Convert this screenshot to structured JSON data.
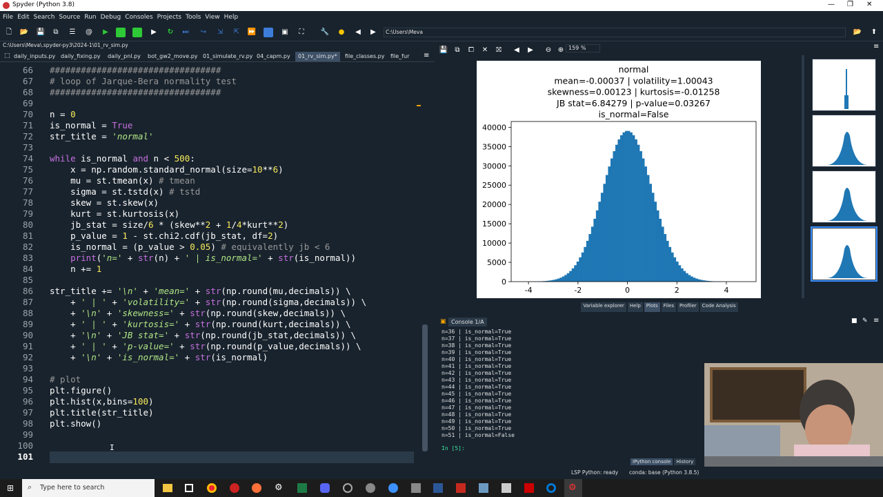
{
  "window": {
    "title": "Spyder (Python 3.8)"
  },
  "menu": [
    "File",
    "Edit",
    "Search",
    "Source",
    "Run",
    "Debug",
    "Consoles",
    "Projects",
    "Tools",
    "View",
    "Help"
  ],
  "toolbar": {
    "cwd": "C:\\Users\\Meva"
  },
  "editor": {
    "path": "C:\\Users\\Meva\\.spyder-py3\\2024-1\\01_rv_sim.py",
    "tabs": [
      "daily_inputs.py",
      "daily_fixing.py",
      "daily_pnl.py",
      "bot_gw2_move.py",
      "01_simulate_rv.py",
      "04_capm.py",
      "01_rv_sim.py*",
      "file_classes.py",
      "file_fur"
    ],
    "active_tab": 6,
    "lines": [
      {
        "n": "66",
        "t": "#################################"
      },
      {
        "n": "67",
        "t": "# loop of Jarque-Bera normality test"
      },
      {
        "n": "68",
        "t": "#################################"
      },
      {
        "n": "69",
        "t": ""
      },
      {
        "n": "70",
        "t": "n = 0"
      },
      {
        "n": "71",
        "t": "is_normal = True"
      },
      {
        "n": "72",
        "t": "str_title = 'normal'"
      },
      {
        "n": "73",
        "t": ""
      },
      {
        "n": "74",
        "t": "while is_normal and n < 500:"
      },
      {
        "n": "75",
        "t": "    x = np.random.standard_normal(size=10**6)"
      },
      {
        "n": "76",
        "t": "    mu = st.tmean(x) # tmean"
      },
      {
        "n": "77",
        "t": "    sigma = st.tstd(x) # tstd"
      },
      {
        "n": "78",
        "t": "    skew = st.skew(x)"
      },
      {
        "n": "79",
        "t": "    kurt = st.kurtosis(x)"
      },
      {
        "n": "80",
        "t": "    jb_stat = size/6 * (skew**2 + 1/4*kurt**2)"
      },
      {
        "n": "81",
        "t": "    p_value = 1 - st.chi2.cdf(jb_stat, df=2)"
      },
      {
        "n": "82",
        "t": "    is_normal = (p_value > 0.05) # equivalently jb < 6"
      },
      {
        "n": "83",
        "t": "    print('n=' + str(n) + ' | is_normal=' + str(is_normal))"
      },
      {
        "n": "84",
        "t": "    n += 1"
      },
      {
        "n": "85",
        "t": ""
      },
      {
        "n": "86",
        "t": "str_title += '\\n' + 'mean=' + str(np.round(mu,decimals)) \\"
      },
      {
        "n": "87",
        "t": "    + ' | ' + 'volatility=' + str(np.round(sigma,decimals)) \\"
      },
      {
        "n": "88",
        "t": "    + '\\n' + 'skewness=' + str(np.round(skew,decimals)) \\"
      },
      {
        "n": "89",
        "t": "    + ' | ' + 'kurtosis=' + str(np.round(kurt,decimals)) \\"
      },
      {
        "n": "90",
        "t": "    + '\\n' + 'JB stat=' + str(np.round(jb_stat,decimals)) \\"
      },
      {
        "n": "91",
        "t": "    + ' | ' + 'p-value=' + str(np.round(p_value,decimals)) \\"
      },
      {
        "n": "92",
        "t": "    + '\\n' + 'is_normal=' + str(is_normal)"
      },
      {
        "n": "93",
        "t": ""
      },
      {
        "n": "94",
        "t": "# plot"
      },
      {
        "n": "95",
        "t": "plt.figure()"
      },
      {
        "n": "96",
        "t": "plt.hist(x,bins=100)"
      },
      {
        "n": "97",
        "t": "plt.title(str_title)"
      },
      {
        "n": "98",
        "t": "plt.show()"
      },
      {
        "n": "99",
        "t": ""
      },
      {
        "n": "100",
        "t": ""
      },
      {
        "n": "101",
        "t": ""
      }
    ]
  },
  "plots": {
    "zoom": "159 %",
    "tabs": [
      "Variable explorer",
      "Help",
      "Plots",
      "Files",
      "Profiler",
      "Code Analysis"
    ]
  },
  "chart_data": {
    "type": "bar",
    "title": "normal\nmean=-0.00037 | volatility=1.00043\nskewness=0.00123 | kurtosis=-0.01258\nJB stat=6.84279 | p-value=0.03267\nis_normal=False",
    "title_lines": [
      "normal",
      "mean=-0.00037 | volatility=1.00043",
      "skewness=0.00123 | kurtosis=-0.01258",
      "JB stat=6.84279 | p-value=0.03267",
      "is_normal=False"
    ],
    "xlim": [
      -4.7,
      5.2
    ],
    "ylim": [
      0,
      41500
    ],
    "xticks": [
      "-4",
      "-2",
      "0",
      "2",
      "4"
    ],
    "xtick_values": [
      -4,
      -2,
      0,
      2,
      4
    ],
    "yticks": [
      "0",
      "5000",
      "10000",
      "15000",
      "20000",
      "25000",
      "30000",
      "35000",
      "40000"
    ],
    "ytick_values": [
      0,
      5000,
      10000,
      15000,
      20000,
      25000,
      30000,
      35000,
      40000
    ],
    "bins": 100,
    "color": "#1f77b4",
    "series_desc": "histogram of standard normal samples, size=10**6"
  },
  "console": {
    "tab": "Console 1/A",
    "lines": [
      "n=36 | is_normal=True",
      "n=37 | is_normal=True",
      "n=38 | is_normal=True",
      "n=39 | is_normal=True",
      "n=40 | is_normal=True",
      "n=41 | is_normal=True",
      "n=42 | is_normal=True",
      "n=43 | is_normal=True",
      "n=44 | is_normal=True",
      "n=45 | is_normal=True",
      "n=46 | is_normal=True",
      "n=47 | is_normal=True",
      "n=48 | is_normal=True",
      "n=49 | is_normal=True",
      "n=50 | is_normal=True",
      "n=51 | is_normal=False"
    ],
    "prompt": "In [5]:",
    "tabs": [
      "IPython console",
      "History"
    ]
  },
  "status": {
    "lsp": "LSP Python: ready",
    "conda": "conda: base (Python 3.8.5)"
  },
  "taskbar": {
    "search_placeholder": "Type here to search"
  }
}
